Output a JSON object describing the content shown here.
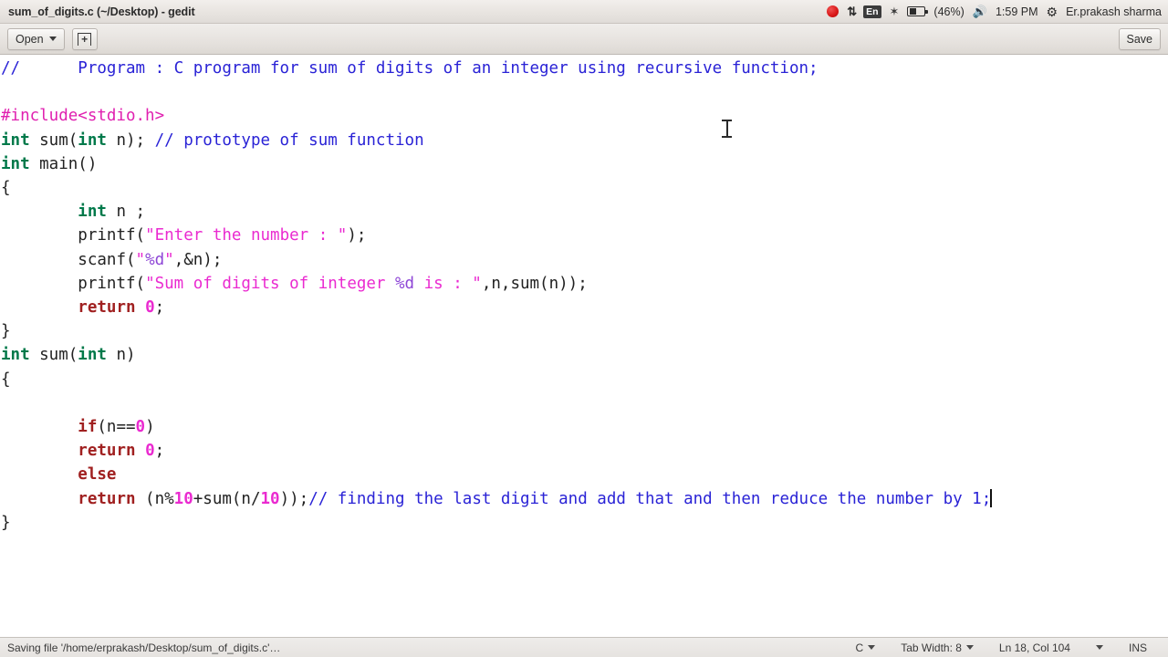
{
  "window": {
    "title": "sum_of_digits.c (~/Desktop) - gedit"
  },
  "tray": {
    "record_icon": "record-dot-icon",
    "network_icon": "network-updown-icon",
    "keyboard_layout": "En",
    "bluetooth_icon": "bluetooth-icon",
    "battery_icon": "battery-icon",
    "battery_percent": "(46%)",
    "volume_icon": "volume-icon",
    "clock": "1:59 PM",
    "settings_icon": "gear-icon",
    "user_name": "Er.prakash sharma"
  },
  "headerbar": {
    "open_label": "Open",
    "new_doc_icon": "new-document-icon",
    "save_label": "Save"
  },
  "editor": {
    "lines": [
      [
        {
          "t": "//      Program : C program for sum of digits of an integer using recursive function;",
          "c": "cmt"
        }
      ],
      [],
      [
        {
          "t": "#include<stdio.h>",
          "c": "pre"
        }
      ],
      [
        {
          "t": "int",
          "c": "kw"
        },
        {
          "t": " sum(",
          "c": ""
        },
        {
          "t": "int",
          "c": "kw"
        },
        {
          "t": " n); ",
          "c": ""
        },
        {
          "t": "// prototype of sum function",
          "c": "cmt"
        }
      ],
      [
        {
          "t": "int",
          "c": "kw"
        },
        {
          "t": " main()",
          "c": ""
        }
      ],
      [
        {
          "t": "{",
          "c": ""
        }
      ],
      [
        {
          "t": "        ",
          "c": ""
        },
        {
          "t": "int",
          "c": "kw"
        },
        {
          "t": " n ;",
          "c": ""
        }
      ],
      [
        {
          "t": "        printf(",
          "c": ""
        },
        {
          "t": "\"Enter the number : \"",
          "c": "str"
        },
        {
          "t": ");",
          "c": ""
        }
      ],
      [
        {
          "t": "        scanf(",
          "c": ""
        },
        {
          "t": "\"",
          "c": "str"
        },
        {
          "t": "%d",
          "c": "fmt"
        },
        {
          "t": "\"",
          "c": "str"
        },
        {
          "t": ",&n);",
          "c": ""
        }
      ],
      [
        {
          "t": "        printf(",
          "c": ""
        },
        {
          "t": "\"Sum of digits of integer ",
          "c": "str"
        },
        {
          "t": "%d",
          "c": "fmt"
        },
        {
          "t": " is : \"",
          "c": "str"
        },
        {
          "t": ",n,sum(n));",
          "c": ""
        }
      ],
      [
        {
          "t": "        ",
          "c": ""
        },
        {
          "t": "return",
          "c": "kw2"
        },
        {
          "t": " ",
          "c": ""
        },
        {
          "t": "0",
          "c": "num"
        },
        {
          "t": ";",
          "c": ""
        }
      ],
      [
        {
          "t": "}",
          "c": ""
        }
      ],
      [
        {
          "t": "int",
          "c": "kw"
        },
        {
          "t": " sum(",
          "c": ""
        },
        {
          "t": "int",
          "c": "kw"
        },
        {
          "t": " n)",
          "c": ""
        }
      ],
      [
        {
          "t": "{",
          "c": ""
        }
      ],
      [],
      [
        {
          "t": "        ",
          "c": ""
        },
        {
          "t": "if",
          "c": "kw2"
        },
        {
          "t": "(n==",
          "c": ""
        },
        {
          "t": "0",
          "c": "num"
        },
        {
          "t": ")",
          "c": ""
        }
      ],
      [
        {
          "t": "        ",
          "c": ""
        },
        {
          "t": "return",
          "c": "kw2"
        },
        {
          "t": " ",
          "c": ""
        },
        {
          "t": "0",
          "c": "num"
        },
        {
          "t": ";",
          "c": ""
        }
      ],
      [
        {
          "t": "        ",
          "c": ""
        },
        {
          "t": "else",
          "c": "kw2"
        }
      ],
      [
        {
          "t": "        ",
          "c": ""
        },
        {
          "t": "return",
          "c": "kw2"
        },
        {
          "t": " (n%",
          "c": ""
        },
        {
          "t": "10",
          "c": "num"
        },
        {
          "t": "+sum(n/",
          "c": ""
        },
        {
          "t": "10",
          "c": "num"
        },
        {
          "t": "));",
          "c": ""
        },
        {
          "t": "// finding the last digit and add that and then reduce the number by 1;",
          "c": "cmt"
        },
        {
          "t": "",
          "c": "caret"
        }
      ],
      [
        {
          "t": "}",
          "c": ""
        }
      ]
    ]
  },
  "statusbar": {
    "message": "Saving file '/home/erprakash/Desktop/sum_of_digits.c'…",
    "language": "C",
    "tab_width": "Tab Width: 8",
    "position": "Ln 18, Col 104",
    "insert_mode": "INS"
  }
}
